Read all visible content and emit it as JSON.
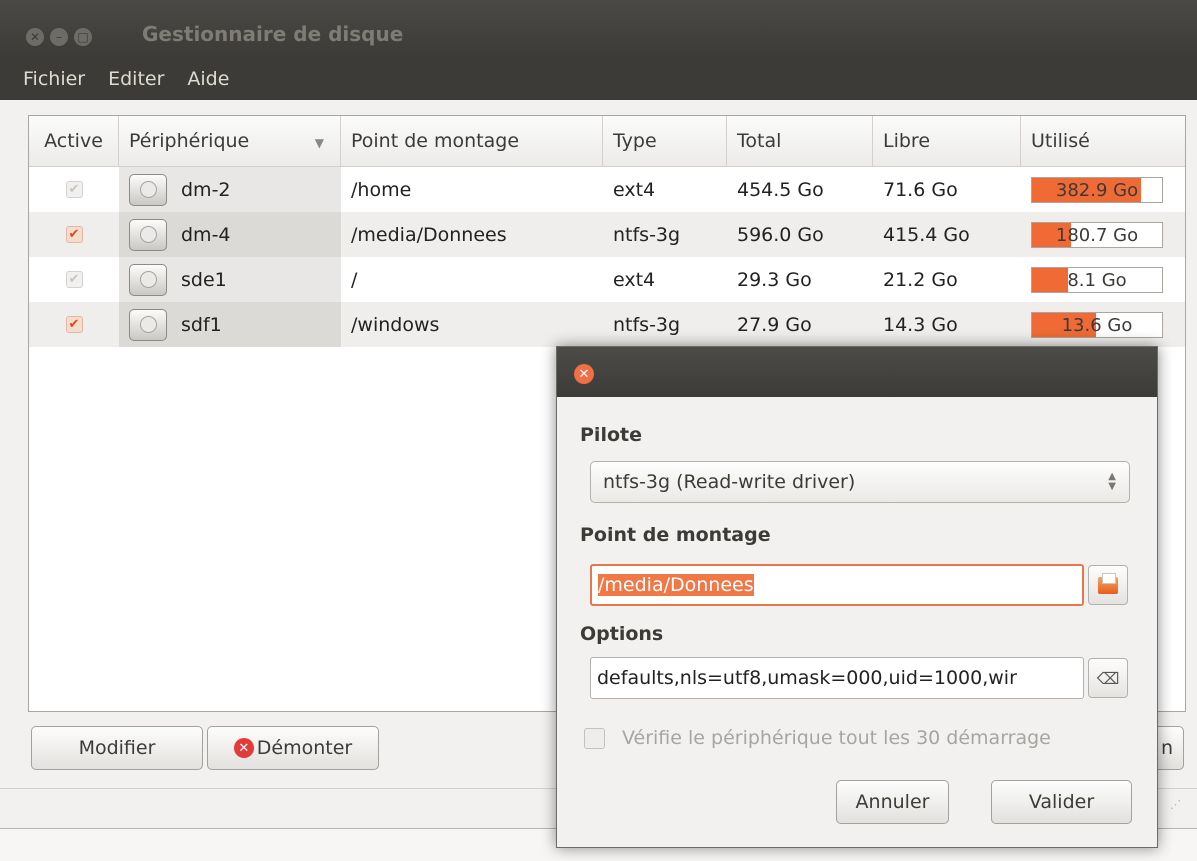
{
  "window": {
    "title": "Gestionnaire de disque",
    "buttons": [
      "close",
      "minimize",
      "maximize"
    ]
  },
  "menubar": {
    "items": [
      "Fichier",
      "Editer",
      "Aide"
    ]
  },
  "table": {
    "columns": [
      "Active",
      "Périphérique",
      "Point de montage",
      "Type",
      "Total",
      "Libre",
      "Utilisé"
    ],
    "rows": [
      {
        "active": false,
        "device": "dm-2",
        "mount": "/home",
        "type": "ext4",
        "total": "454.5 Go",
        "free": "71.6 Go",
        "used": "382.9 Go",
        "used_fraction": 0.84
      },
      {
        "active": true,
        "device": "dm-4",
        "mount": "/media/Donnees",
        "type": "ntfs-3g",
        "total": "596.0 Go",
        "free": "415.4 Go",
        "used": "180.7 Go",
        "used_fraction": 0.3
      },
      {
        "active": false,
        "device": "sde1",
        "mount": "/",
        "type": "ext4",
        "total": "29.3 Go",
        "free": "21.2 Go",
        "used": "8.1 Go",
        "used_fraction": 0.28
      },
      {
        "active": true,
        "device": "sdf1",
        "mount": "/windows",
        "type": "ntfs-3g",
        "total": "27.9 Go",
        "free": "14.3 Go",
        "used": "13.6 Go",
        "used_fraction": 0.49
      }
    ]
  },
  "actions": {
    "modify_label": "Modifier",
    "unmount_label": "Démonter",
    "hidden_button_fragment": "n"
  },
  "dialog": {
    "driver_label": "Pilote",
    "driver_value": "ntfs-3g (Read-write driver)",
    "mount_label": "Point de montage",
    "mount_value": "/media/Donnees",
    "options_label": "Options",
    "options_value": "defaults,nls=utf8,umask=000,uid=1000,wir",
    "check_label": "Vérifie le périphérique tout les 30 démarrage",
    "check_value": false,
    "cancel_label": "Annuler",
    "ok_label": "Valider"
  },
  "icons": {
    "close": "close-icon",
    "minimize": "minimize-icon",
    "maximize": "maximize-icon",
    "disk": "hard-disk-icon",
    "unmount": "error-x-icon",
    "folder": "folder-icon",
    "clear": "clear-text-icon",
    "sort": "sort-down-icon"
  },
  "colors": {
    "accent": "#ef6a35",
    "titlebar": "#3c3b37",
    "window_bg": "#f2f1f0"
  }
}
